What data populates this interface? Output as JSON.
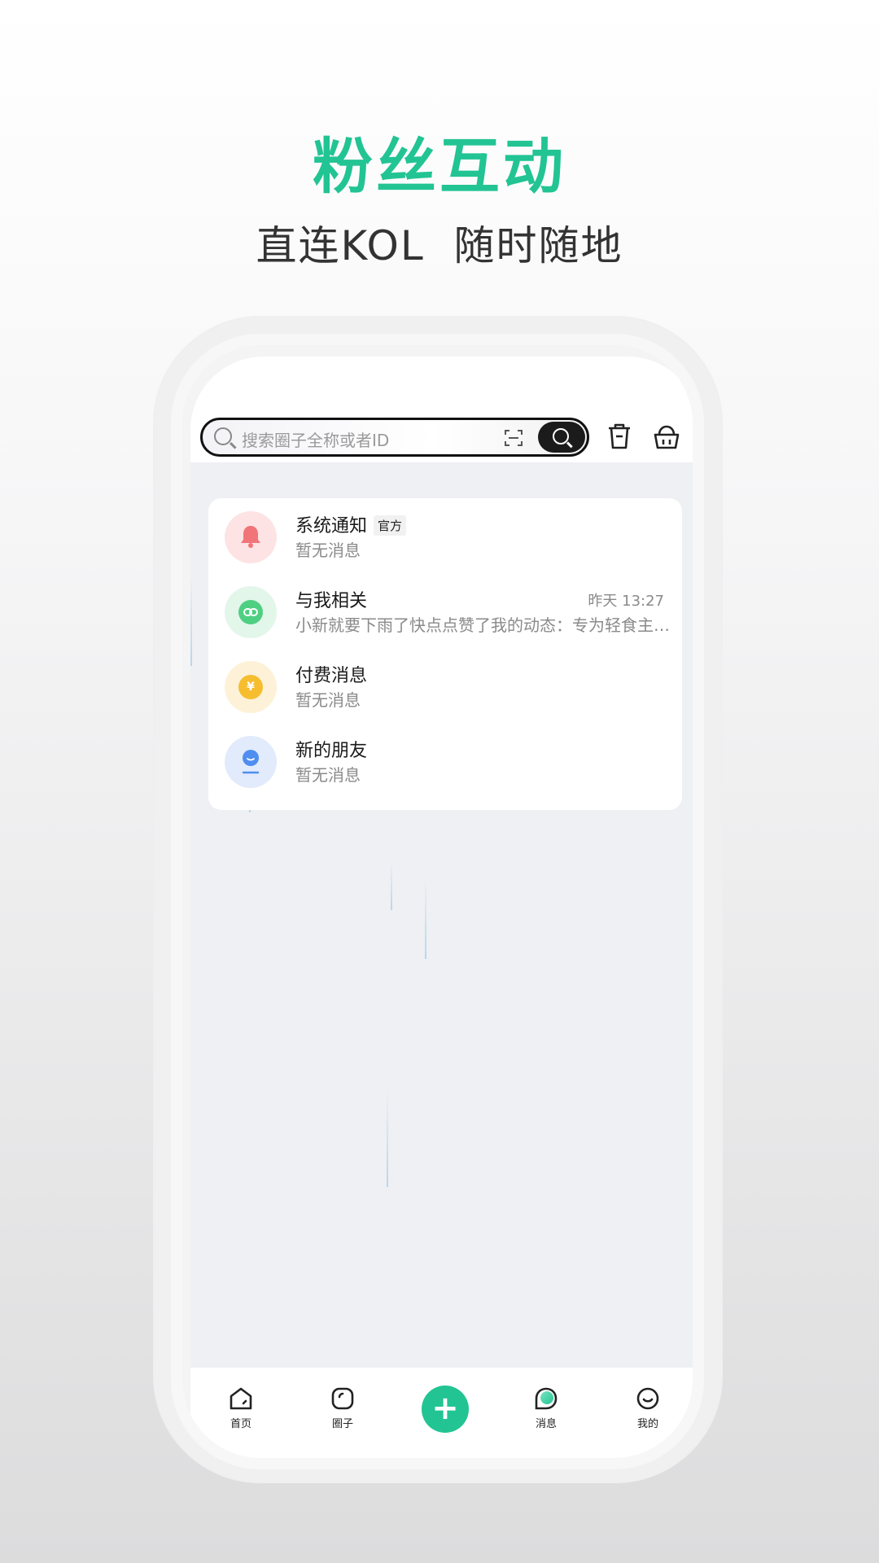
{
  "hero": {
    "title": "粉丝互动",
    "subtitle": "直连KOL  随时随地"
  },
  "search": {
    "placeholder": "搜索圈子全称或者ID",
    "icon": "search-icon",
    "scan_icon": "scan-icon"
  },
  "toolbar": {
    "icons": [
      "trash-icon",
      "basket-icon"
    ]
  },
  "messages": [
    {
      "title": "系统通知",
      "badge": "官方",
      "subtitle": "暂无消息",
      "time": "",
      "icon": "bell-icon",
      "bg": "#fde3e4",
      "fg": "#f07478"
    },
    {
      "title": "与我相关",
      "badge": "",
      "subtitle": "小新就要下雨了快点点赞了我的动态：专为轻食主义者准备的",
      "time": "昨天 13:27",
      "icon": "link-icon",
      "bg": "#e3f6ea",
      "fg": "#4fcf82"
    },
    {
      "title": "付费消息",
      "badge": "",
      "subtitle": "暂无消息",
      "time": "",
      "icon": "yuan-icon",
      "bg": "#fdf2d8",
      "fg": "#f6bd2f"
    },
    {
      "title": "新的朋友",
      "badge": "",
      "subtitle": "暂无消息",
      "time": "",
      "icon": "friend-icon",
      "bg": "#e2ebfb",
      "fg": "#4f8ef0"
    }
  ],
  "tabbar": {
    "items": [
      {
        "label": "首页",
        "icon": "home-icon"
      },
      {
        "label": "圈子",
        "icon": "circle-icon"
      },
      {
        "label": "",
        "icon": "plus-icon"
      },
      {
        "label": "消息",
        "icon": "message-icon"
      },
      {
        "label": "我的",
        "icon": "profile-icon"
      }
    ]
  },
  "colors": {
    "accent": "#22c493"
  }
}
